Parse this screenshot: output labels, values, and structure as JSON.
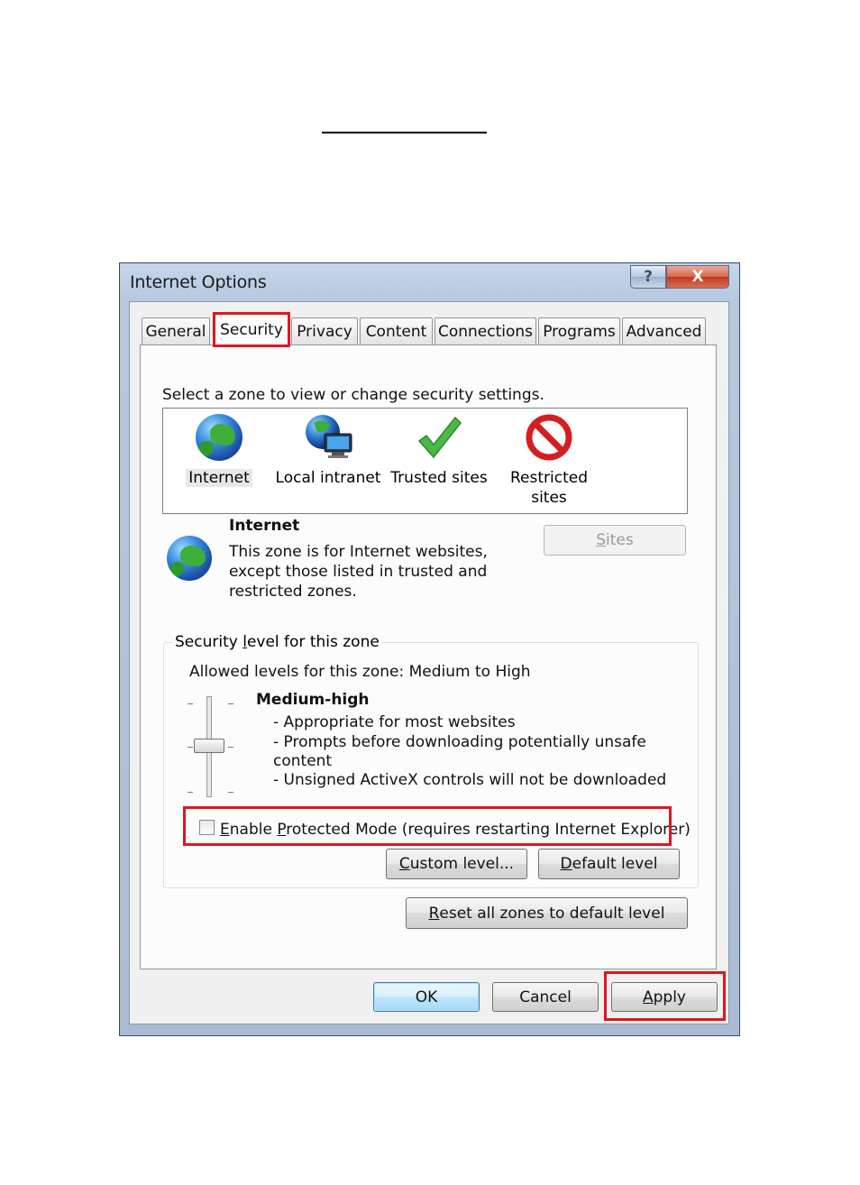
{
  "window": {
    "title": "Internet Options",
    "help_glyph": "?",
    "close_glyph": "X"
  },
  "tabs": [
    {
      "label": "General"
    },
    {
      "label": "Security"
    },
    {
      "label": "Privacy"
    },
    {
      "label": "Content"
    },
    {
      "label": "Connections"
    },
    {
      "label": "Programs"
    },
    {
      "label": "Advanced"
    }
  ],
  "security": {
    "zone_prompt": "Select a zone to view or change security settings.",
    "zones": [
      {
        "label": "Internet",
        "icon": "globe-icon"
      },
      {
        "label": "Local intranet",
        "icon": "intranet-icon"
      },
      {
        "label": "Trusted sites",
        "icon": "checkmark-icon"
      },
      {
        "label_line1": "Restricted",
        "label_line2": "sites",
        "icon": "restricted-icon"
      }
    ],
    "selected_zone": {
      "name": "Internet",
      "desc_line1": "This zone is for Internet websites,",
      "desc_line2": "except those listed in trusted and",
      "desc_line3": "restricted zones."
    },
    "sites_button": {
      "pre": "",
      "key": "S",
      "post": "ites"
    },
    "level_group": {
      "title_pre": "Security ",
      "title_key": "l",
      "title_post": "evel for this zone",
      "allowed": "Allowed levels for this zone: Medium to High",
      "level_name": "Medium-high",
      "bullet1": "- Appropriate for most websites",
      "bullet2": "- Prompts before downloading potentially unsafe",
      "bullet2_cont": "content",
      "bullet3": "- Unsigned ActiveX controls will not be downloaded"
    },
    "protected_mode": {
      "key": "E",
      "pre": "nable ",
      "key2": "P",
      "post": "rotected Mode (requires restarting Internet Explorer)",
      "checked": false
    },
    "custom_level_button": {
      "key": "C",
      "post": "ustom level..."
    },
    "default_level_button": {
      "key": "D",
      "post": "efault level"
    },
    "reset_button": {
      "key": "R",
      "post": "eset all zones to default level"
    }
  },
  "footer": {
    "ok": "OK",
    "cancel": "Cancel",
    "apply_key": "A",
    "apply_post": "pply"
  },
  "colors": {
    "highlight_box": "#e0161d",
    "window_frame": "#b7c9df"
  }
}
